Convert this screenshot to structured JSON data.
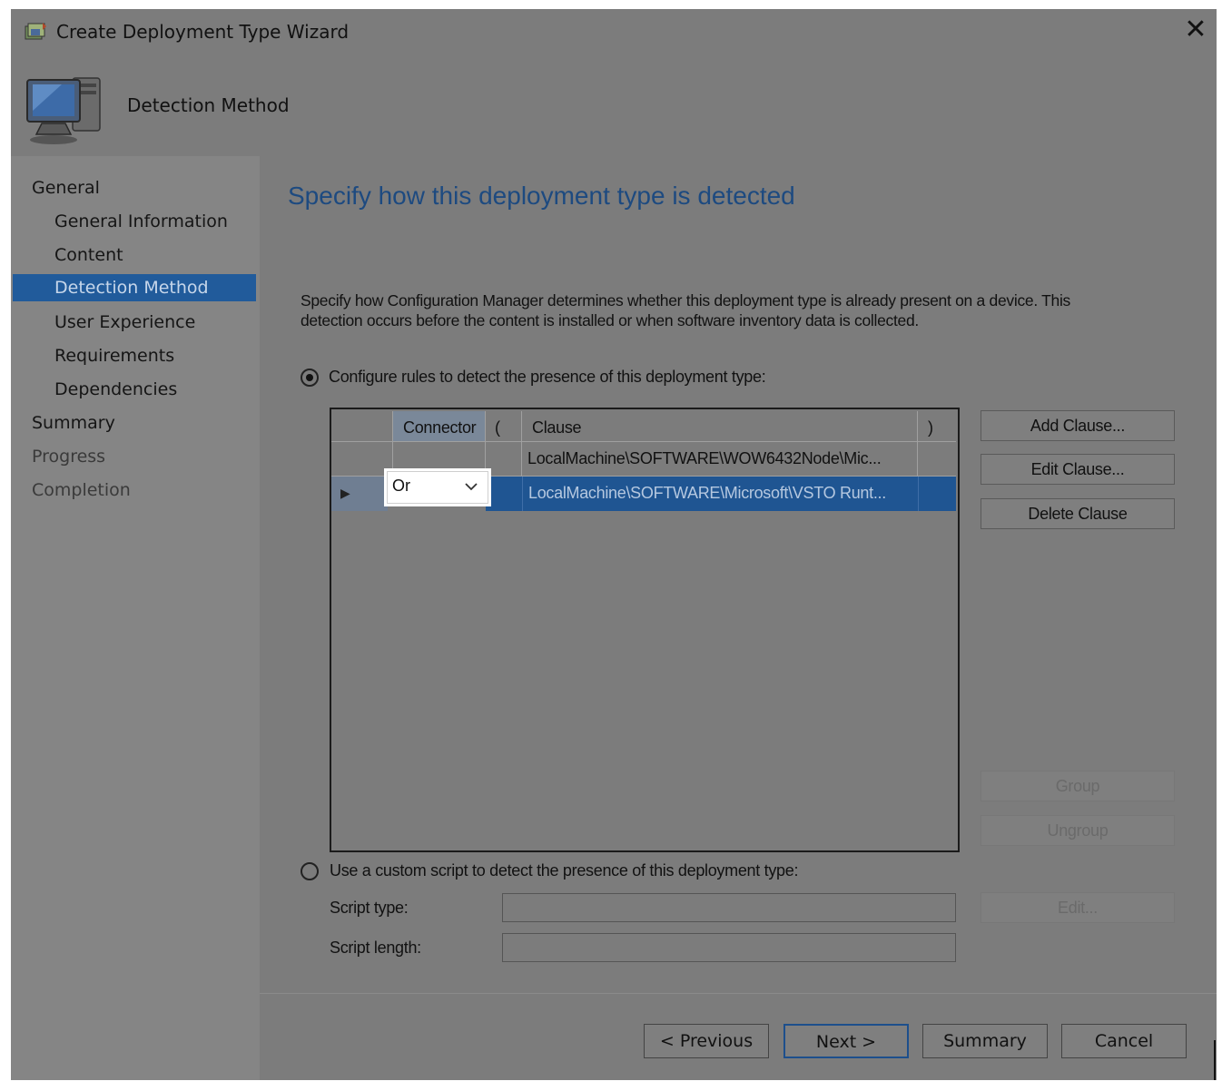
{
  "window": {
    "title": "Create Deployment Type Wizard",
    "close_glyph": "✕"
  },
  "header": {
    "page_title": "Detection Method"
  },
  "nav": {
    "items": [
      {
        "label": "General"
      },
      {
        "label": "General Information"
      },
      {
        "label": "Content"
      },
      {
        "label": "Detection Method"
      },
      {
        "label": "User Experience"
      },
      {
        "label": "Requirements"
      },
      {
        "label": "Dependencies"
      },
      {
        "label": "Summary"
      },
      {
        "label": "Progress"
      },
      {
        "label": "Completion"
      }
    ],
    "active_index": 3
  },
  "main": {
    "heading": "Specify how this deployment type is detected",
    "description": "Specify how Configuration Manager determines whether this deployment type is already present on a device. This detection occurs before the content is installed or when software inventory data is collected.",
    "option_rules": {
      "label": "Configure rules to detect the presence of this deployment type:",
      "selected": true
    },
    "option_script": {
      "label": "Use a custom script to detect the presence of this deployment type:",
      "selected": false
    }
  },
  "grid": {
    "columns": {
      "connector": "Connector",
      "open_paren": "(",
      "clause": "Clause",
      "close_paren": ")"
    },
    "rows": [
      {
        "connector": "",
        "open_paren": "",
        "clause": "LocalMachine\\SOFTWARE\\WOW6432Node\\Mic...",
        "close_paren": ""
      },
      {
        "connector": "Or",
        "open_paren": "",
        "clause": "LocalMachine\\SOFTWARE\\Microsoft\\VSTO Runt...",
        "close_paren": "",
        "selected": true
      }
    ],
    "row_indicator": "▶"
  },
  "side_buttons": {
    "add_clause": "Add Clause...",
    "edit_clause": "Edit Clause...",
    "delete_clause": "Delete Clause",
    "group": "Group",
    "ungroup": "Ungroup",
    "edit": "Edit..."
  },
  "script": {
    "type_label": "Script type:",
    "type_value": "",
    "length_label": "Script length:",
    "length_value": ""
  },
  "footer": {
    "previous": "< Previous",
    "next": "Next >",
    "summary": "Summary",
    "cancel": "Cancel"
  },
  "colors": {
    "selection": "#215b9b",
    "heading": "#1d4a80",
    "dim_background": "#7c7c7c",
    "highlight_box": "#ffffff"
  }
}
